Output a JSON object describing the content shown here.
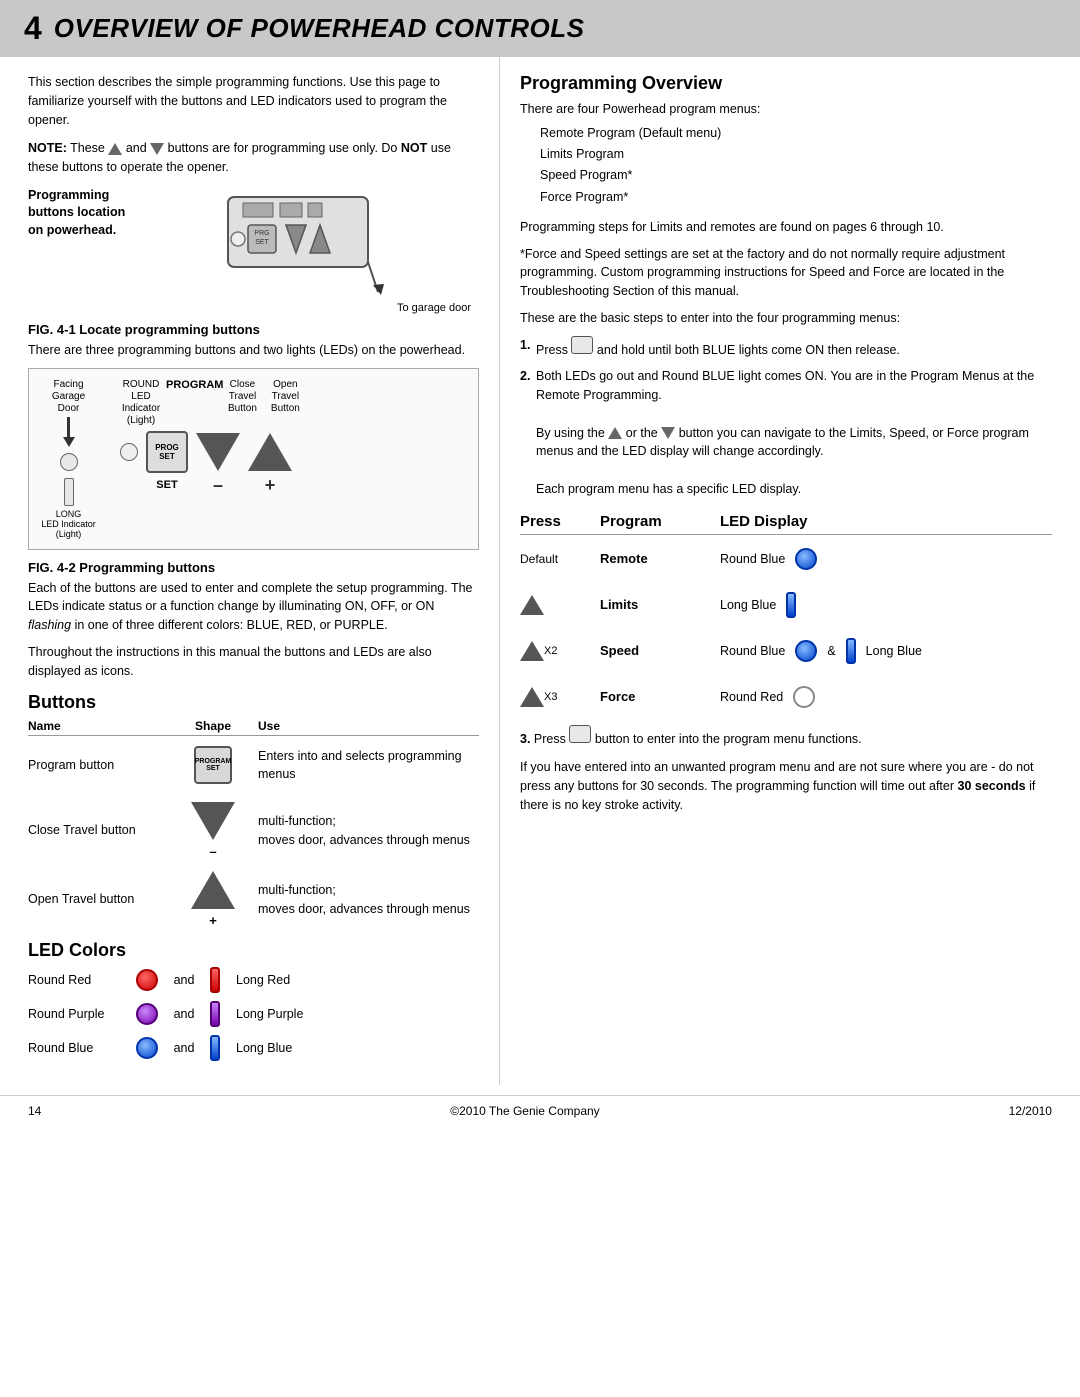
{
  "page": {
    "chapter_num": "4",
    "chapter_title": "OVERVIEW OF POWERHEAD CONTROLS",
    "footer_left": "14",
    "footer_center": "©2010 The Genie Company",
    "footer_right": "12/2010"
  },
  "left": {
    "intro": "This section describes the simple programming functions. Use this page to familiarize yourself with the buttons and LED indicators used to program the opener.",
    "note_prefix": "NOTE:",
    "note_text": " These",
    "note_text2": "and",
    "note_text3": "buttons are for programming use only. Do ",
    "note_not": "NOT",
    "note_text4": " use these buttons to operate the opener.",
    "powerhead_label1": "Programming",
    "powerhead_label2": "buttons location",
    "powerhead_label3": "on powerhead.",
    "to_garage_label": "To garage door",
    "fig1_title": "FIG. 4-1   Locate programming buttons",
    "fig1_desc": "There are three programming buttons and two lights (LEDs) on the powerhead.",
    "led_label_round": "ROUND\nLED Indicator\n(Light)",
    "led_label_long": "LONG\nLED Indicator\n(Light)",
    "facing_label": "Facing\nGarage Door",
    "program_label": "PROGRAM",
    "set_label": "SET",
    "close_travel": "Close\nTravel\nButton",
    "open_travel": "Open\nTravel\nButton",
    "fig2_title": "FIG. 4-2   Programming buttons",
    "fig2_desc1": "Each of the buttons are used to enter and complete the setup programming. The LEDs indicate status or a function change by illuminating ON, OFF, or ON",
    "fig2_desc_italic": " flashing",
    "fig2_desc2": " in one of three different colors: BLUE, RED, or PURPLE.",
    "fig2_desc3": "Throughout the instructions in this manual the buttons and LEDs are also displayed as icons.",
    "buttons_title": "Buttons",
    "col_name": "Name",
    "col_shape": "Shape",
    "col_use": "Use",
    "btn1_name": "Program button",
    "btn1_use": "Enters into and selects programming menus",
    "btn2_name": "Close Travel button",
    "btn2_use1": "multi-function;",
    "btn2_use2": "moves door, advances through menus",
    "btn3_name": "Open Travel button",
    "btn3_use1": "multi-function;",
    "btn3_use2": "moves door, advances through menus",
    "led_colors_title": "LED Colors",
    "color1_name": "Round Red",
    "color1_and": "and",
    "color1_long": "Long Red",
    "color2_name": "Round Purple",
    "color2_and": "and",
    "color2_long": "Long Purple",
    "color3_name": "Round Blue",
    "color3_and": "and",
    "color3_long": "Long Blue"
  },
  "right": {
    "prog_overview_title": "Programming Overview",
    "prog_overview_intro": "There are four Powerhead program menus:",
    "menus": [
      "Remote Program (Default menu)",
      "Limits Program",
      "Speed Program*",
      "Force Program*"
    ],
    "steps_text": "Programming steps for Limits and remotes are found on pages 6 through 10.",
    "asterisk_text": "*Force and Speed settings are set at the factory and do not normally require adjustment programming. Custom programming instructions for Speed and Force are located in the Troubleshooting Section of this manual.",
    "basic_intro": "These are the basic steps to enter into the four programming menus:",
    "step1_num": "1.",
    "step1_text": "Press",
    "step1_text2": "and hold until both BLUE lights come ON then release.",
    "step2_num": "2.",
    "step2_text1": "Both LEDs go out and Round BLUE light comes ON. You are in the Program Menus at the Remote Programming.",
    "step2_text2": "By using the",
    "step2_text3": "or the",
    "step2_text4": "button you can navigate to the Limits, Speed, or Force program menus and the LED display will change accordingly.",
    "step2_text5": "Each program menu has a specific LED display.",
    "ppl_col_press": "Press",
    "ppl_col_program": "Program",
    "ppl_col_led": "LED Display",
    "ppl_rows": [
      {
        "press": "Default",
        "program": "Remote",
        "led": "Round Blue"
      },
      {
        "press": "",
        "program": "Limits",
        "led": "Long Blue"
      },
      {
        "press": "X2",
        "program": "Speed",
        "led": "Round Blue & Long Blue"
      },
      {
        "press": "X3",
        "program": "Force",
        "led": "Round Red"
      }
    ],
    "step3_text": "3.  Press",
    "step3_text2": "button to enter into the program menu functions.",
    "final_text1": "If you have entered into an unwanted program menu and are not sure where you are - do not press any buttons for 30 seconds. The programming function will time out after ",
    "final_bold": "30 seconds",
    "final_text2": " if there is no key stroke activity."
  }
}
